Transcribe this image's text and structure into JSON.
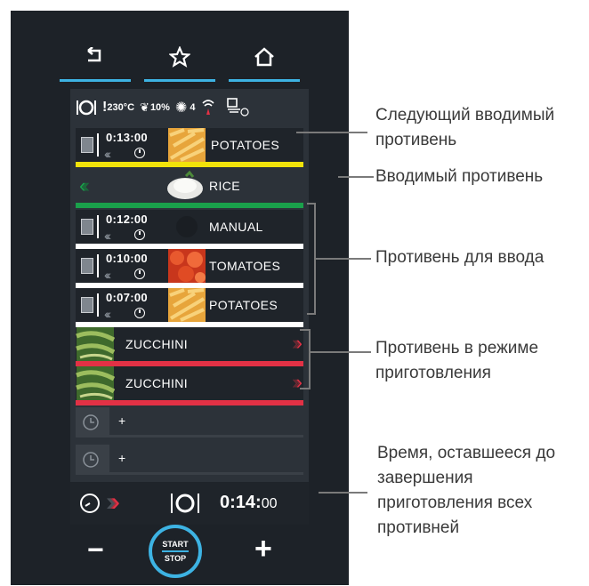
{
  "nav": {
    "back_icon": "undo-arrow-icon",
    "favorites_icon": "star-icon",
    "home_icon": "home-icon",
    "bar_color": "#3db3e3"
  },
  "status": {
    "temperature": "230°C",
    "humidity": "10%",
    "fan_speed": "4",
    "icons": [
      "tray-ring-icon",
      "temperature-icon",
      "humidity-icon",
      "fan-icon",
      "wifi-icon",
      "cleaning-icon"
    ]
  },
  "trays": [
    {
      "time": "0:13:00",
      "name": "POTATOES",
      "state": "next",
      "color": "#f2e30a"
    },
    {
      "time": "",
      "name": "RICE",
      "state": "loading",
      "color": "#1aa04b"
    },
    {
      "time": "0:12:00",
      "name": "MANUAL",
      "state": "to-load",
      "color": "#ffffff"
    },
    {
      "time": "0:10:00",
      "name": "TOMATOES",
      "state": "to-load",
      "color": "#ffffff"
    },
    {
      "time": "0:07:00",
      "name": "POTATOES",
      "state": "to-load",
      "color": "#ffffff"
    },
    {
      "time": "",
      "name": "ZUCCHINI",
      "state": "cooking",
      "color": "#e23145"
    },
    {
      "time": "",
      "name": "ZUCCHINI",
      "state": "cooking",
      "color": "#e23145"
    }
  ],
  "empty_slots": [
    "+",
    "+"
  ],
  "total_time": {
    "main": "0:14:",
    "seconds": "00"
  },
  "controls": {
    "minus": "−",
    "plus": "+",
    "start": "START",
    "stop": "STOP",
    "ring_color": "#3db3e3"
  },
  "callouts": {
    "next": "Следующий вводимый противень",
    "loading": "Вводимый противень",
    "to_load": "Противень для ввода",
    "cooking": "Противень в режиме приготовления",
    "remaining": "Время, оставшееся до завершения приготовления всех противней"
  }
}
